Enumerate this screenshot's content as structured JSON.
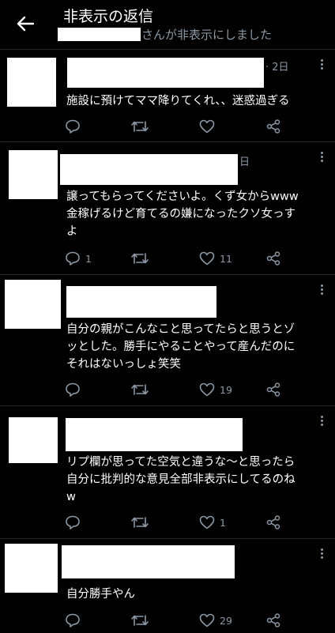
{
  "header": {
    "title": "非表示の返信",
    "subtitle": "さんが非表示にしました"
  },
  "tweets": [
    {
      "time": "· 2日",
      "text": "施設に預けてママ降りてくれ、、迷惑過ぎる",
      "reply_count": "",
      "like_count": ""
    },
    {
      "time": "日",
      "text": "譲ってもらってくださいよ。くず女からwww\n金稼げるけど育てるの嫌になったクソ女っす\nよ",
      "reply_count": "1",
      "like_count": "11"
    },
    {
      "time": "",
      "text": "自分の親がこんなこと思ってたらと思うとゾ\nッとした。勝手にやることやって産んだのに\nそれはないっしょ笑笑",
      "reply_count": "",
      "like_count": "19"
    },
    {
      "time": "",
      "text": "リプ欄が思ってた空気と違うな〜と思ったら\n自分に批判的な意見全部非表示にしてるのね\nw",
      "reply_count": "",
      "like_count": "1"
    },
    {
      "time": "",
      "text": "自分勝手やん",
      "reply_count": "",
      "like_count": "29"
    }
  ]
}
